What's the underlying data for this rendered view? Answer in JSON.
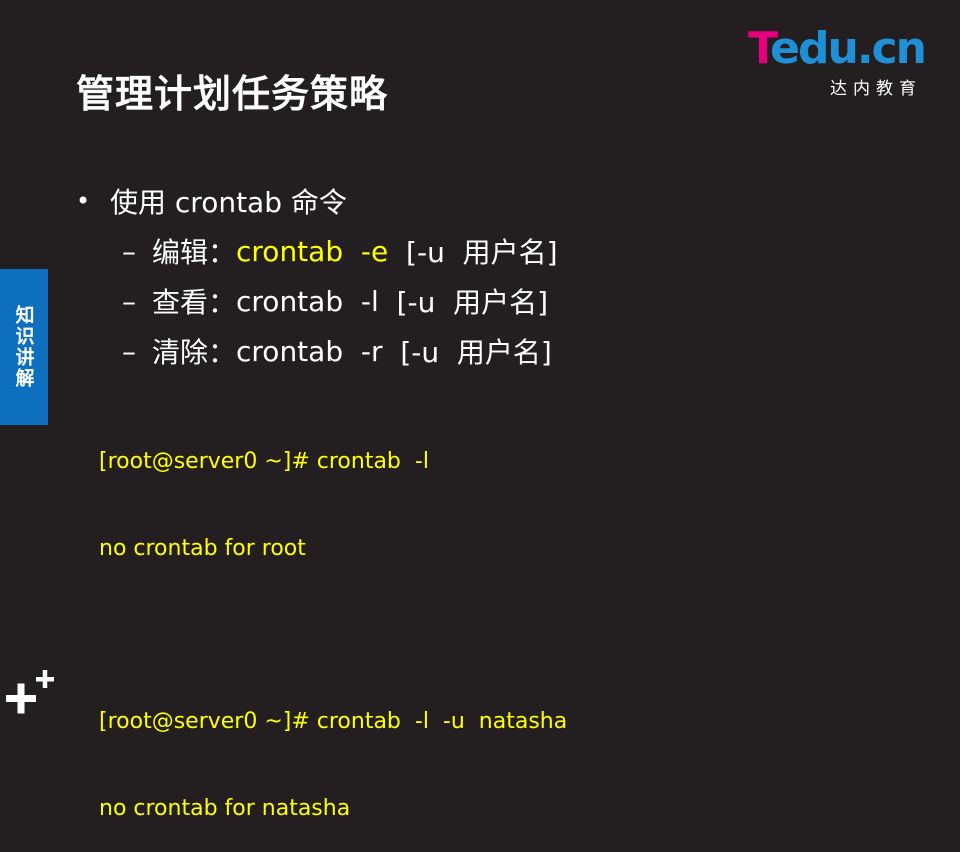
{
  "slide": {
    "title": "管理计划任务策略",
    "logo": {
      "brand_first": "T",
      "brand_rest": "edu.cn",
      "subtitle": "达内教育"
    },
    "side_tab": "知识讲解",
    "bullet": {
      "marker": "•",
      "text": "使用 crontab 命令"
    },
    "sub_items": [
      {
        "dash": "–",
        "label": "编辑：",
        "command": "crontab  -e",
        "args": "  [-u  用户名]"
      },
      {
        "dash": "–",
        "label": "查看：",
        "command": "crontab  -l",
        "args": "  [-u  用户名]"
      },
      {
        "dash": "–",
        "label": "清除：",
        "command": "crontab  -r",
        "args": "  [-u  用户名]"
      }
    ],
    "terminal_lines": [
      "[root@server0 ~]# crontab  -l",
      "no crontab for root",
      "[root@server0 ~]# crontab  -l  -u  natasha",
      "no crontab for natasha"
    ]
  },
  "colors": {
    "background": "#231f20",
    "accent_yellow": "#ffff00",
    "side_tab_blue": "#0f6fbf",
    "logo_magenta": "#e6007e",
    "logo_blue": "#1f8fd6"
  },
  "icons": {
    "corner": "plus-plus-icon"
  }
}
